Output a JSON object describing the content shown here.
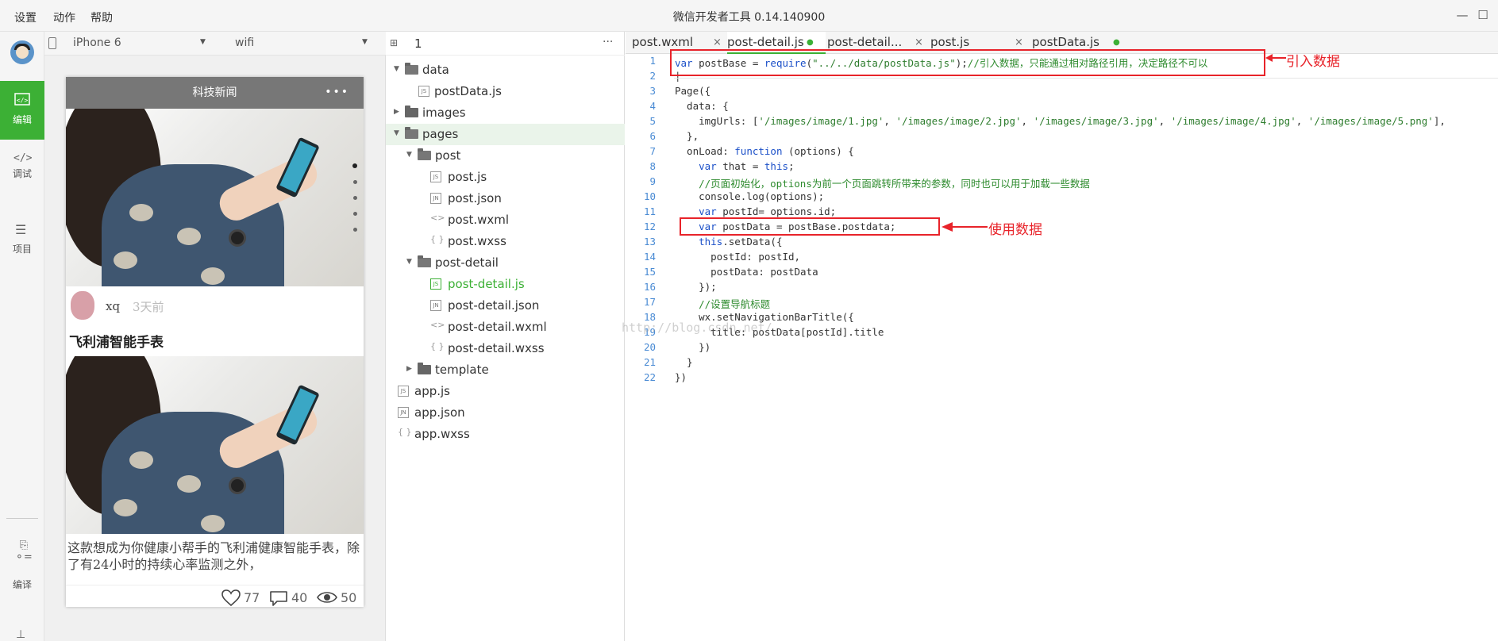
{
  "menu": {
    "settings": "设置",
    "action": "动作",
    "help": "帮助"
  },
  "app_title": "微信开发者工具 0.14.140900",
  "sidebar": {
    "items": [
      {
        "label": "编辑"
      },
      {
        "label": "调试"
      },
      {
        "label": "项目"
      },
      {
        "label": "编译"
      }
    ]
  },
  "simulator": {
    "device": "iPhone 6",
    "network": "wifi",
    "page": {
      "nav_title": "科技新闻",
      "nav_dots": "•••",
      "author": "xq",
      "time": "3天前",
      "post_title": "飞利浦智能手表",
      "desc": "这款想成为你健康小帮手的飞利浦健康智能手表，除了有24小时的持续心率监测之外，",
      "likes": "77",
      "comments": "40",
      "views": "50"
    }
  },
  "filetree": {
    "count": "1",
    "more": "···",
    "items": [
      {
        "name": "data",
        "type": "folder"
      },
      {
        "name": "postData.js",
        "type": "JS"
      },
      {
        "name": "images",
        "type": "folder"
      },
      {
        "name": "pages",
        "type": "folder"
      },
      {
        "name": "post",
        "type": "folder"
      },
      {
        "name": "post.js",
        "type": "JS"
      },
      {
        "name": "post.json",
        "type": "JN"
      },
      {
        "name": "post.wxml",
        "type": "wxml"
      },
      {
        "name": "post.wxss",
        "type": "wxss"
      },
      {
        "name": "post-detail",
        "type": "folder"
      },
      {
        "name": "post-detail.js",
        "type": "JS"
      },
      {
        "name": "post-detail.json",
        "type": "JN"
      },
      {
        "name": "post-detail.wxml",
        "type": "wxml"
      },
      {
        "name": "post-detail.wxss",
        "type": "wxss"
      },
      {
        "name": "template",
        "type": "folder"
      },
      {
        "name": "app.js",
        "type": "JS"
      },
      {
        "name": "app.json",
        "type": "JN"
      },
      {
        "name": "app.wxss",
        "type": "wxss"
      }
    ]
  },
  "tabs": [
    {
      "label": "post.wxml"
    },
    {
      "label": "post-detail.js"
    },
    {
      "label": "post-detail..."
    },
    {
      "label": "post.js"
    },
    {
      "label": "postData.js"
    }
  ],
  "editor": {
    "annotations": {
      "import": "引入数据",
      "use": "使用数据"
    },
    "watermark": "http://blog.csdn.net/...",
    "line_numbers": [
      "1",
      "2",
      "3",
      "4",
      "5",
      "6",
      "7",
      "8",
      "9",
      "10",
      "11",
      "12",
      "13",
      "14",
      "15",
      "16",
      "17",
      "18",
      "19",
      "20",
      "21",
      "22"
    ]
  }
}
